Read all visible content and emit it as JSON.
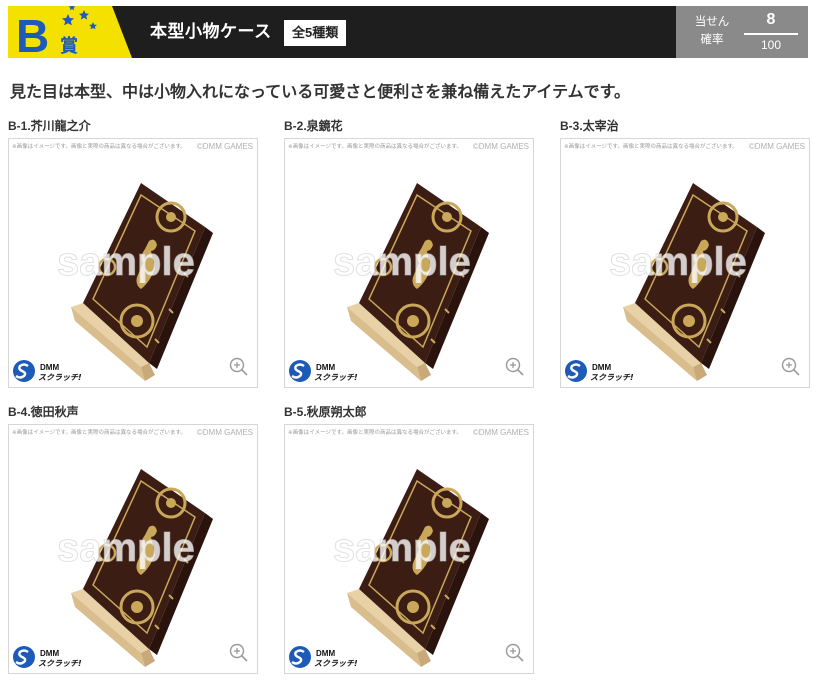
{
  "header": {
    "badge_letter": "B",
    "badge_kanji": "賞",
    "prize_title": "本型小物ケース",
    "count_tag": "全5種類",
    "rate_label_1": "当せん",
    "rate_label_2": "確率",
    "rate_numerator": "8",
    "rate_denominator": "100"
  },
  "description": "見た目は本型、中は小物入れになっている可愛さと便利さを兼ね備えたアイテムです。",
  "image_note": "※画像はイメージです。画像と実際の商品は異なる場合がございます。",
  "image_copyright": "©DMM GAMES",
  "watermark": "sample",
  "brand": {
    "top": "DMM",
    "bottom": "スクラッチ!"
  },
  "items": [
    {
      "label": "B-1.芥川龍之介"
    },
    {
      "label": "B-2.泉鏡花"
    },
    {
      "label": "B-3.太宰治"
    },
    {
      "label": "B-4.徳田秋声"
    },
    {
      "label": "B-5.秋原朔太郎"
    }
  ],
  "colors": {
    "header_bg": "#1e1e1e",
    "badge_yellow": "#f5e100",
    "badge_blue": "#1e5bb8",
    "rate_bg": "#8a8a8a",
    "book_brown": "#3b1d14",
    "book_gold": "#c9a85a"
  }
}
